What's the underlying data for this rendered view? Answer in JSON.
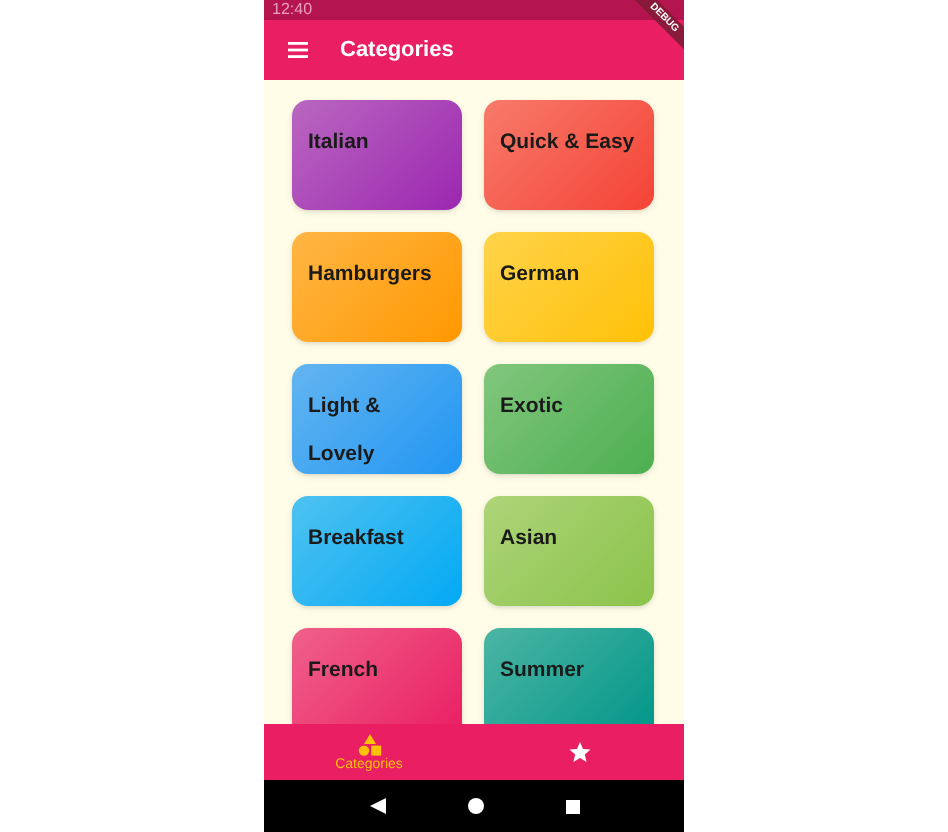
{
  "status_bar": {
    "time": "12:40"
  },
  "debug_banner": "DEBUG",
  "app_bar": {
    "title": "Categories"
  },
  "categories": [
    {
      "title": "Italian",
      "color": "#9c27b0"
    },
    {
      "title": "Quick & Easy",
      "color": "#f44336"
    },
    {
      "title": "Hamburgers",
      "color": "#ff9800"
    },
    {
      "title": "German",
      "color": "#ffc107"
    },
    {
      "title": "Light & Lovely",
      "color": "#2196f3"
    },
    {
      "title": "Exotic",
      "color": "#4caf50"
    },
    {
      "title": "Breakfast",
      "color": "#03a9f4"
    },
    {
      "title": "Asian",
      "color": "#8bc34a"
    },
    {
      "title": "French",
      "color": "#e91e63"
    },
    {
      "title": "Summer",
      "color": "#009688"
    }
  ],
  "bottom_nav": [
    {
      "kind": "categories",
      "label": "Categories",
      "selected": true
    },
    {
      "kind": "favorites",
      "selected": false
    }
  ]
}
